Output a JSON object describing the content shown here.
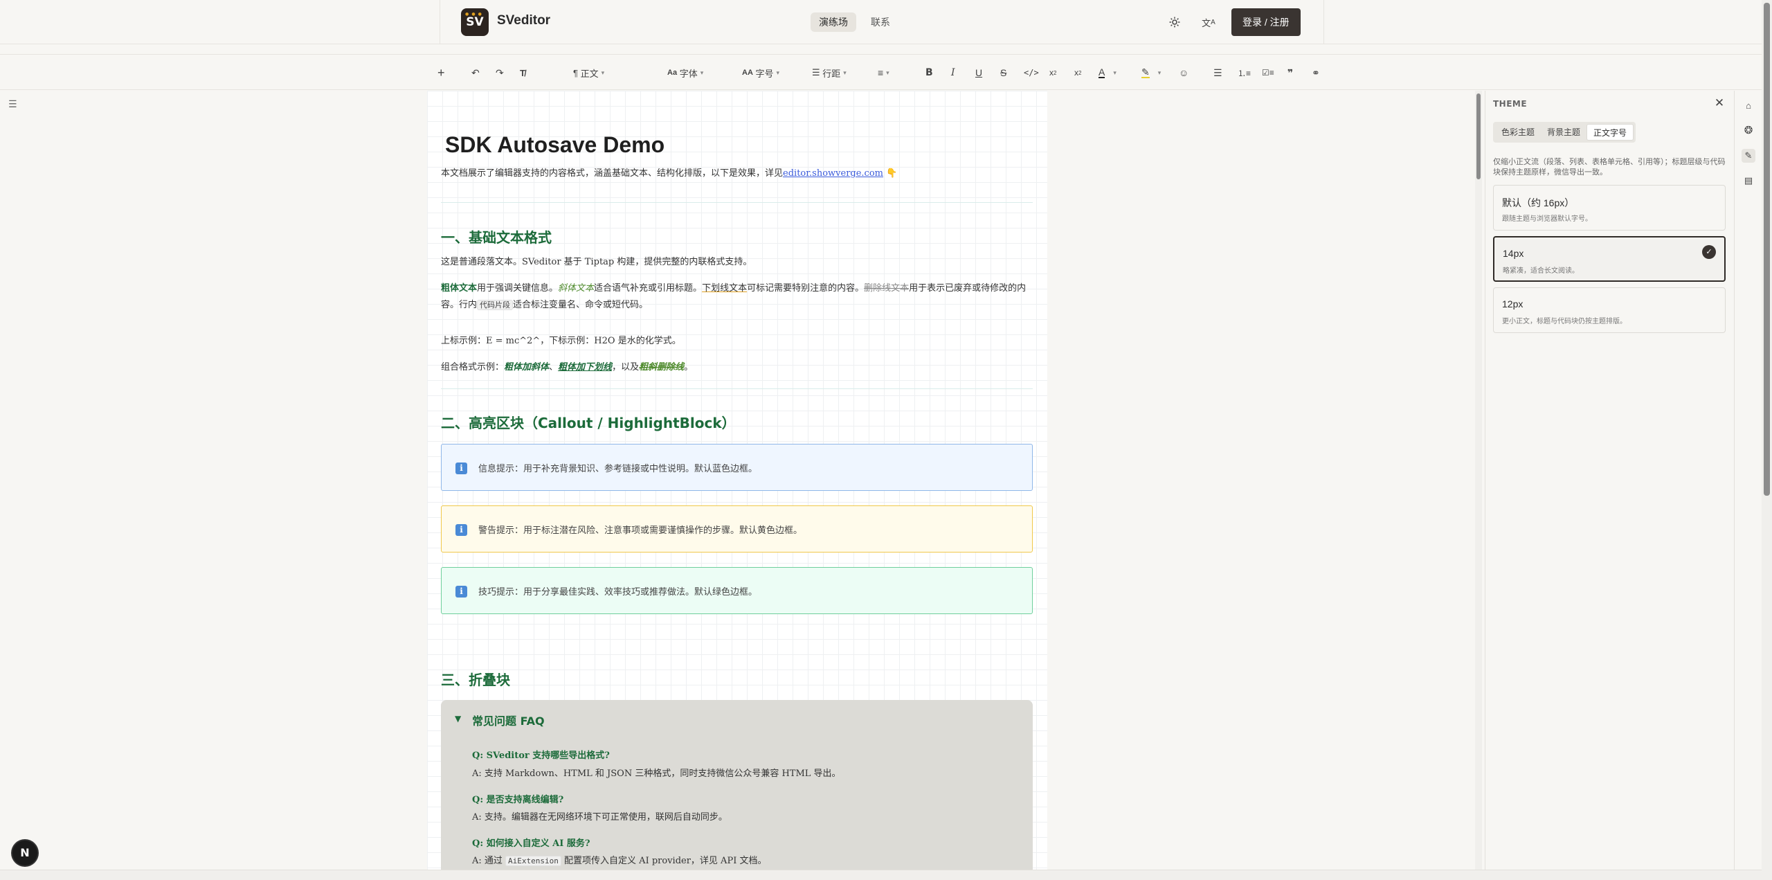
{
  "app": {
    "logo_text": "SV",
    "brand": "SVeditor",
    "nav_active": "演练场",
    "nav_link": "联系",
    "login": "登录 / 注册",
    "theme_icon": "sun-icon",
    "lang_icon": "translate-icon"
  },
  "toolbar": {
    "paragraph": "正文",
    "font": "字体",
    "font_size": "字号",
    "line_height": "行距",
    "paragraph_prefix": "¶",
    "font_prefix": "Aa",
    "size_prefix": "AA",
    "icons": [
      "plus-icon",
      "undo-icon",
      "redo-icon",
      "clear-format-icon",
      "align-icon",
      "bold-icon",
      "italic-icon",
      "underline-icon",
      "strikethrough-icon",
      "code-icon",
      "superscript-icon",
      "subscript-icon",
      "text-color-icon",
      "highlight-icon",
      "emoji-icon",
      "bullet-list-icon",
      "ordered-list-icon",
      "task-list-icon",
      "quote-icon",
      "link-icon"
    ]
  },
  "doc": {
    "title": "SDK Autosave Demo",
    "intro": "本文档展示了编辑器支持的内容格式，涵盖基础文本、结构化排版，以下是效果，详见",
    "intro_link": "editor.showverge.com",
    "intro_emoji": "👇",
    "h1": "一、基础文本格式",
    "p1": "这是普通段落文本。SVeditor 基于 Tiptap 构建，提供完整的内联格式支持。",
    "p2": {
      "bold": "粗体文本",
      "t1": "用于强调关键信息。",
      "italic": "斜体文本",
      "t2": "适合语气补充或引用标题。",
      "underline": "下划线文本",
      "t3": "可标记需要特别注意的内容。",
      "strike": "删除线文本",
      "t4": "用于表示已废弃或待修改的内容。行内",
      "code": "代码片段",
      "t5": "适合标注变量名、命令或短代码。"
    },
    "p3": "上标示例：E = mc^2^，下标示例：H2O 是水的化学式。",
    "p4": {
      "lead": "组合格式示例：",
      "a": "粗体加斜体",
      "sep1": "、",
      "b": "粗体加下划线",
      "sep2": "，以及",
      "c": "粗斜删除线",
      "end": "。"
    },
    "h2": "二、高亮区块（Callout / HighlightBlock）",
    "callout_info": "信息提示：用于补充背景知识、参考链接或中性说明。默认蓝色边框。",
    "callout_warn": "警告提示：用于标注潜在风险、注意事项或需要谨慎操作的步骤。默认黄色边框。",
    "callout_tip": "技巧提示：用于分享最佳实践、效率技巧或推荐做法。默认绿色边框。",
    "callout_icon": "i",
    "h3": "三、折叠块",
    "fold_title": "常见问题 FAQ",
    "faq": [
      {
        "q": "Q: SVeditor 支持哪些导出格式?",
        "a": "A: 支持 Markdown、HTML 和 JSON 三种格式，同时支持微信公众号兼容 HTML 导出。"
      },
      {
        "q": "Q: 是否支持离线编辑?",
        "a": "A: 支持。编辑器在无网络环境下可正常使用，联网后自动同步。"
      },
      {
        "q": "Q: 如何接入自定义 AI 服务?",
        "a_pre": "A: 通过",
        "a_code": "AiExtension",
        "a_post": "配置项传入自定义 AI provider，详见 API 文档。"
      }
    ]
  },
  "theme_panel": {
    "title": "THEME",
    "tabs": [
      "色彩主题",
      "背景主题",
      "正文字号"
    ],
    "active_tab": 2,
    "desc": "仅缩小正文流（段落、列表、表格单元格、引用等）；标题层级与代码块保持主题原样，微信导出一致。",
    "options": [
      {
        "label": "默认（约 16px）",
        "sub": "跟随主题与浏览器默认字号。"
      },
      {
        "label": "14px",
        "sub": "略紧凑，适合长文阅读。"
      },
      {
        "label": "12px",
        "sub": "更小正文，标题与代码块仍按主题排版。"
      }
    ],
    "selected": 1
  },
  "badge": "N"
}
